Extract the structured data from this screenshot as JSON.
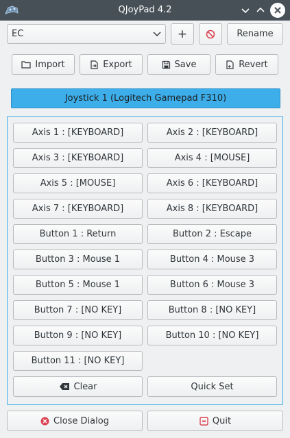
{
  "window": {
    "title": "QJoyPad 4.2"
  },
  "toolbar": {
    "layout_value": "EC",
    "add_label": "+",
    "rename_label": "Rename",
    "import_label": "Import",
    "export_label": "Export",
    "save_label": "Save",
    "revert_label": "Revert"
  },
  "joystick_tab": {
    "label": "Joystick 1 (Logitech Gamepad F310)"
  },
  "mappings": [
    "Axis 1 : [KEYBOARD]",
    "Axis 2 : [KEYBOARD]",
    "Axis 3 : [KEYBOARD]",
    "Axis 4 : [MOUSE]",
    "Axis 5 : [MOUSE]",
    "Axis 6 : [KEYBOARD]",
    "Axis 7 : [KEYBOARD]",
    "Axis 8 : [KEYBOARD]",
    "Button 1 : Return",
    "Button 2 : Escape",
    "Button 3 : Mouse 1",
    "Button 4 : Mouse 3",
    "Button 5 : Mouse 1",
    "Button 6 : Mouse 3",
    "Button 7 : [NO KEY]",
    "Button 8 : [NO KEY]",
    "Button 9 : [NO KEY]",
    "Button 10 : [NO KEY]",
    "Button 11 : [NO KEY]"
  ],
  "actions": {
    "clear_label": "Clear",
    "quick_set_label": "Quick Set"
  },
  "footer": {
    "close_label": "Close Dialog",
    "quit_label": "Quit"
  },
  "colors": {
    "accent": "#3daee9",
    "danger": "#da4453",
    "titlebar": "#475057"
  }
}
